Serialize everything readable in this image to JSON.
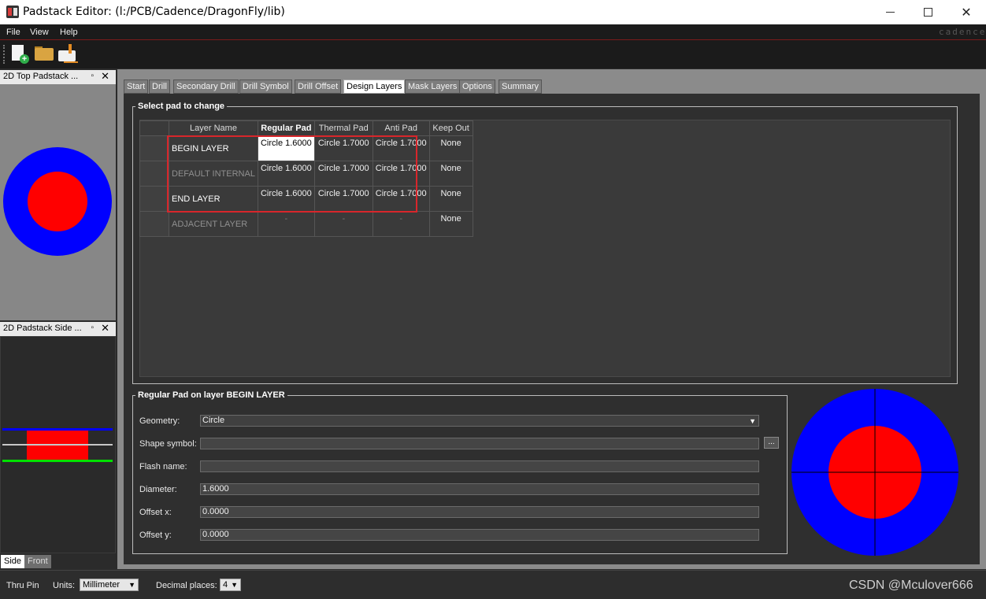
{
  "window": {
    "title": "Padstack Editor:   (l:/PCB/Cadence/DragonFly/lib)",
    "minimize_icon": "minimize-icon",
    "maximize_icon": "maximize-icon",
    "close_glyph": "✕"
  },
  "menu": {
    "file": "File",
    "view": "View",
    "help": "Help",
    "brand": "cadence"
  },
  "toolbar": {
    "icons": [
      "new-file-icon",
      "open-folder-icon",
      "save-folder-icon"
    ]
  },
  "left_docks": {
    "top_view": {
      "title": "2D Top Padstack ...",
      "float_glyph": "▫",
      "close_glyph": "✕"
    },
    "side_view": {
      "title": "2D Padstack Side ...",
      "float_glyph": "▫",
      "close_glyph": "✕"
    },
    "tabs": {
      "side": "Side",
      "front": "Front"
    }
  },
  "tabs": [
    "Start",
    "Drill",
    "Secondary Drill",
    "Drill Symbol",
    "Drill Offset",
    "Design Layers",
    "Mask Layers",
    "Options",
    "Summary"
  ],
  "active_tab": "Design Layers",
  "select_pad_group": {
    "title": "Select pad to change",
    "columns": [
      "Layer Name",
      "Regular Pad",
      "Thermal Pad",
      "Anti Pad",
      "Keep Out"
    ],
    "rows": [
      {
        "layer": "BEGIN LAYER",
        "regular": "Circle 1.6000",
        "thermal": "Circle 1.7000",
        "anti": "Circle 1.7000",
        "keepout": "None"
      },
      {
        "layer": "DEFAULT INTERNAL",
        "regular": "Circle 1.6000",
        "thermal": "Circle 1.7000",
        "anti": "Circle 1.7000",
        "keepout": "None"
      },
      {
        "layer": "END LAYER",
        "regular": "Circle 1.6000",
        "thermal": "Circle 1.7000",
        "anti": "Circle 1.7000",
        "keepout": "None"
      },
      {
        "layer": "ADJACENT LAYER",
        "regular": "-",
        "thermal": "-",
        "anti": "-",
        "keepout": "None"
      }
    ]
  },
  "regular_pad_group": {
    "title": "Regular Pad on layer BEGIN LAYER",
    "geometry_label": "Geometry:",
    "geometry_value": "Circle",
    "shape_symbol_label": "Shape symbol:",
    "shape_symbol_value": "",
    "browse_label": "...",
    "flash_name_label": "Flash name:",
    "flash_name_value": "",
    "diameter_label": "Diameter:",
    "diameter_value": "1.6000",
    "offset_x_label": "Offset x:",
    "offset_x_value": "0.0000",
    "offset_y_label": "Offset y:",
    "offset_y_value": "0.0000"
  },
  "status": {
    "pin_type": "Thru Pin",
    "units_label": "Units:",
    "units_value": "Millimeter",
    "decimal_label": "Decimal places:",
    "decimal_value": "4",
    "dropdown_glyph": "▼"
  },
  "watermark": "CSDN @Mculover666",
  "colors": {
    "pad": "#ff0000",
    "antipad": "#0000ff",
    "top_layer_line": "#0000ff",
    "bottom_layer_line": "#00e000",
    "highlight_box": "#d8262b"
  }
}
